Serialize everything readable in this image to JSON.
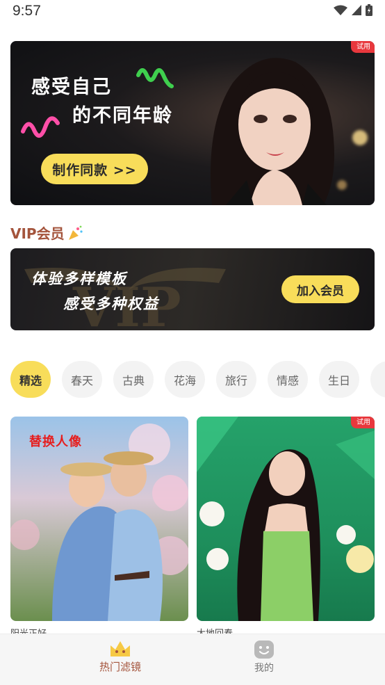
{
  "status_bar": {
    "time": "9:57"
  },
  "banner": {
    "line1": "感受自己",
    "line2": "的不同年龄",
    "cta_label": "制作同款 >>",
    "badge": "试用"
  },
  "vip": {
    "title": "VIP会员",
    "line1": "体验多样模板",
    "line2": "感受多种权益",
    "join_label": "加入会员"
  },
  "tabs": [
    "精选",
    "春天",
    "古典",
    "花海",
    "旅行",
    "情感",
    "生日"
  ],
  "active_tab": "精选",
  "cards": [
    {
      "overlay_label": "替换人像",
      "title": "阳光正好"
    },
    {
      "badge": "试用",
      "title": "大地回春"
    }
  ],
  "bottom_nav": {
    "items": [
      {
        "label": "热门滤镜",
        "icon": "crown-icon",
        "active": true
      },
      {
        "label": "我的",
        "icon": "smiley-icon",
        "active": false
      }
    ]
  },
  "colors": {
    "accent_yellow": "#f8dd5a",
    "brand_brown": "#a4543c",
    "badge_red": "#e8383d"
  }
}
